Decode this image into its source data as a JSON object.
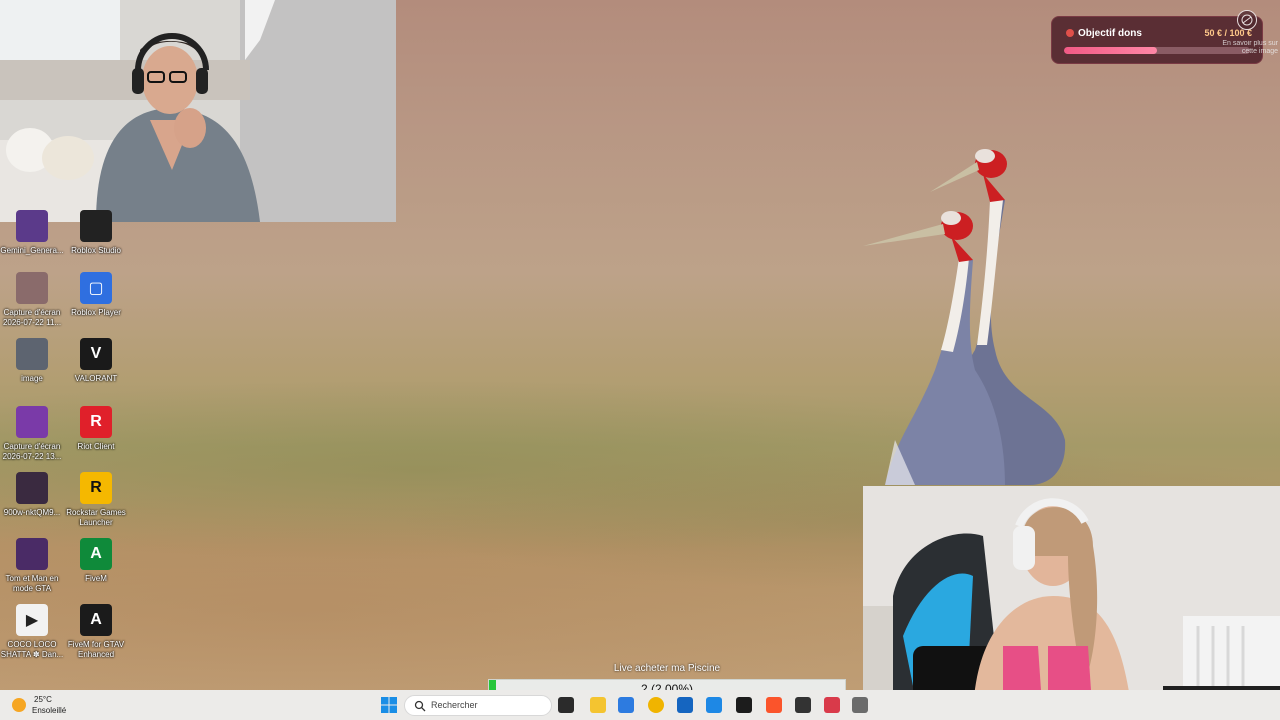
{
  "desktop": {
    "icons": [
      {
        "label": "Gemini_Genera...",
        "name": "gemini-generated-image-file"
      },
      {
        "label": "Roblox Studio",
        "name": "roblox-studio-shortcut"
      },
      {
        "label": "Capture d'écran 2026-07-22 11...",
        "name": "screenshot-file-1"
      },
      {
        "label": "Roblox Player",
        "name": "roblox-player-shortcut"
      },
      {
        "label": "image",
        "name": "image-file"
      },
      {
        "label": "VALORANT",
        "name": "valorant-shortcut"
      },
      {
        "label": "Capture d'écran 2026-07-22 13...",
        "name": "screenshot-file-2"
      },
      {
        "label": "Riot Client",
        "name": "riot-client-shortcut"
      },
      {
        "label": "900w-nktQM9...",
        "name": "image-file-900w"
      },
      {
        "label": "Rockstar Games Launcher",
        "name": "rockstar-games-launcher-shortcut"
      },
      {
        "label": "Tom et Man en mode GTA",
        "name": "video-file-tom-et-man"
      },
      {
        "label": "FiveM",
        "name": "fivem-shortcut"
      },
      {
        "label": "COCO LOCO SHATTA ✽ Dan...",
        "name": "media-file-coco-loco"
      },
      {
        "label": "FiveM for GTAV Enhanced",
        "name": "fivem-gtav-enhanced-shortcut"
      }
    ]
  },
  "donation_goal": {
    "title": "Objectif dons",
    "amount": "50 € / 100 €",
    "progress": 0.5,
    "hint": "En savoir plus sur cette image"
  },
  "live_goal": {
    "title": "Live acheter ma Piscine",
    "progress_text": "2 (2.00%)",
    "progress": 0.02
  },
  "taskbar": {
    "weather_temp": "25°C",
    "weather_desc": "Ensoleillé",
    "search_placeholder": "Rechercher",
    "apps": [
      "terminal-icon",
      "file-explorer-icon",
      "microsoft-store-icon",
      "chrome-icon",
      "outlook-icon",
      "vscode-icon",
      "app-icon",
      "brave-icon",
      "app-icon",
      "app-icon",
      "app-icon"
    ]
  },
  "colors": {
    "goal_fill": "#f25a85",
    "live_fill": "#26c63a",
    "taskbar_bg": "#ecebe9"
  }
}
